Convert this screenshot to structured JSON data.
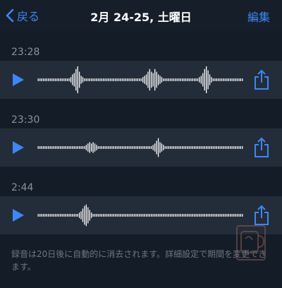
{
  "nav": {
    "back_label": "戻る",
    "title": "2月 24-25, 土曜日",
    "edit_label": "編集"
  },
  "recordings": [
    {
      "time": "23:28",
      "waveform": [
        1,
        1,
        1,
        1,
        1,
        1,
        1,
        1,
        1,
        1,
        1,
        1,
        1,
        1,
        1,
        1,
        1,
        1,
        1,
        2,
        4,
        5,
        8,
        10,
        6,
        3,
        2,
        1,
        1,
        1,
        1,
        1,
        1,
        1,
        1,
        1,
        1,
        1,
        1,
        1,
        1,
        1,
        1,
        1,
        1,
        1,
        1,
        1,
        1,
        1,
        1,
        1,
        1,
        1,
        1,
        1,
        1,
        1,
        1,
        1,
        1,
        2,
        3,
        4,
        6,
        8,
        6,
        5,
        8,
        6,
        4,
        3,
        2,
        1,
        1,
        1,
        1,
        1,
        1,
        1,
        1,
        1,
        1,
        1,
        1,
        1,
        1,
        1,
        1,
        1,
        1,
        1,
        1,
        1,
        2,
        3,
        5,
        8,
        10,
        7,
        4,
        2,
        1,
        1,
        1,
        1,
        1,
        1,
        1,
        1,
        1,
        1,
        1,
        1,
        1,
        1,
        1,
        1,
        1,
        1
      ]
    },
    {
      "time": "23:30",
      "waveform": [
        1,
        1,
        1,
        1,
        1,
        1,
        1,
        1,
        1,
        1,
        1,
        1,
        1,
        1,
        1,
        1,
        1,
        1,
        1,
        1,
        1,
        1,
        1,
        1,
        1,
        1,
        1,
        1,
        2,
        3,
        4,
        3,
        4,
        3,
        2,
        1,
        1,
        1,
        1,
        1,
        1,
        1,
        1,
        1,
        1,
        1,
        1,
        1,
        1,
        1,
        1,
        1,
        1,
        1,
        1,
        1,
        1,
        1,
        1,
        1,
        1,
        1,
        1,
        1,
        1,
        1,
        1,
        2,
        3,
        5,
        7,
        4,
        3,
        2,
        1,
        1,
        1,
        1,
        1,
        1,
        1,
        1,
        1,
        1,
        1,
        1,
        1,
        1,
        1,
        1,
        1,
        1,
        1,
        1,
        1,
        1,
        1,
        1,
        1,
        1,
        1,
        1,
        1,
        1,
        1,
        1,
        1,
        1,
        1,
        1,
        1,
        1,
        1,
        1,
        1,
        1,
        1,
        1,
        1,
        1
      ]
    },
    {
      "time": "2:44",
      "waveform": [
        1,
        1,
        1,
        1,
        1,
        1,
        1,
        1,
        1,
        1,
        1,
        1,
        1,
        1,
        1,
        1,
        1,
        1,
        1,
        1,
        1,
        1,
        1,
        1,
        2,
        3,
        5,
        7,
        8,
        6,
        4,
        2,
        1,
        1,
        1,
        1,
        1,
        1,
        1,
        1,
        1,
        1,
        1,
        1,
        1,
        1,
        1,
        1,
        1,
        1,
        1,
        1,
        1,
        1,
        1,
        1,
        1,
        1,
        1,
        1,
        1,
        1,
        1,
        1,
        1,
        1,
        1,
        1,
        1,
        1,
        1,
        1,
        1,
        1,
        1,
        1,
        1,
        1,
        1,
        1,
        1,
        1,
        1,
        1,
        1,
        1,
        1,
        1,
        1,
        1,
        1,
        1,
        1,
        1,
        1,
        1,
        1,
        1,
        1,
        1,
        1,
        1,
        1,
        1,
        1,
        1,
        1,
        1,
        1,
        1,
        1,
        1,
        1,
        1,
        1,
        1,
        1,
        1,
        1,
        1
      ]
    }
  ],
  "footer_text": "録音は20日後に自動的に消去されます。詳細設定で期間を変更できます。",
  "colors": {
    "accent": "#3d86f5",
    "background": "#141c27",
    "row": "#232d39",
    "secondary_text": "#8a919a"
  },
  "icons": {
    "back": "chevron-left-icon",
    "play": "play-icon",
    "share": "share-icon"
  }
}
